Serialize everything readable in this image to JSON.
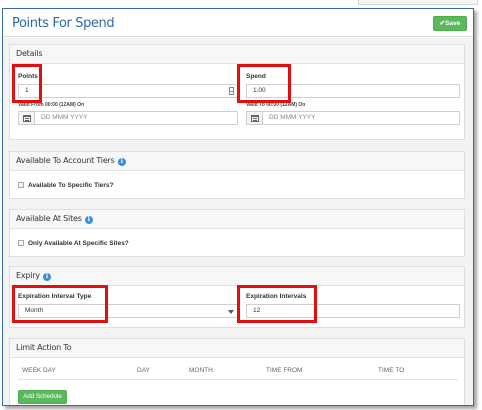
{
  "page": {
    "title": "Points For Spend",
    "save_label": "✔Save"
  },
  "details": {
    "title": "Details",
    "points": {
      "label": "Points",
      "value": "1"
    },
    "spend": {
      "label": "Spend",
      "value": "1.00"
    },
    "valid_from": {
      "label": "Valid From 00:00 (12AM) On",
      "placeholder": "DD MMM YYYY"
    },
    "valid_to": {
      "label": "Valid To 00:00 (12AM) On",
      "placeholder": "DD MMM YYYY"
    }
  },
  "tiers": {
    "title": "Available To Account Tiers",
    "checkbox_label": "Available To Specific Tiers?"
  },
  "sites": {
    "title": "Available At Sites",
    "checkbox_label": "Only Available At Specific Sites?"
  },
  "expiry": {
    "title": "Expiry",
    "interval_type": {
      "label": "Expiration Interval Type",
      "value": "Month"
    },
    "intervals": {
      "label": "Expiration Intervals",
      "value": "12"
    }
  },
  "limit": {
    "title": "Limit Action To",
    "columns": [
      "WEEK DAY",
      "DAY",
      "MONTH",
      "TIME FROM",
      "TIME TO"
    ],
    "add_label": "Add Schedule"
  },
  "colors": {
    "accent": "#2c6aa8",
    "save_green": "#5cb85c",
    "highlight_red": "#e01010",
    "info_blue": "#3a8fd9"
  },
  "icons": [
    "check-icon",
    "info-icon",
    "calendar-icon",
    "stepper-icon",
    "caret-down-icon",
    "checkbox-icon"
  ]
}
